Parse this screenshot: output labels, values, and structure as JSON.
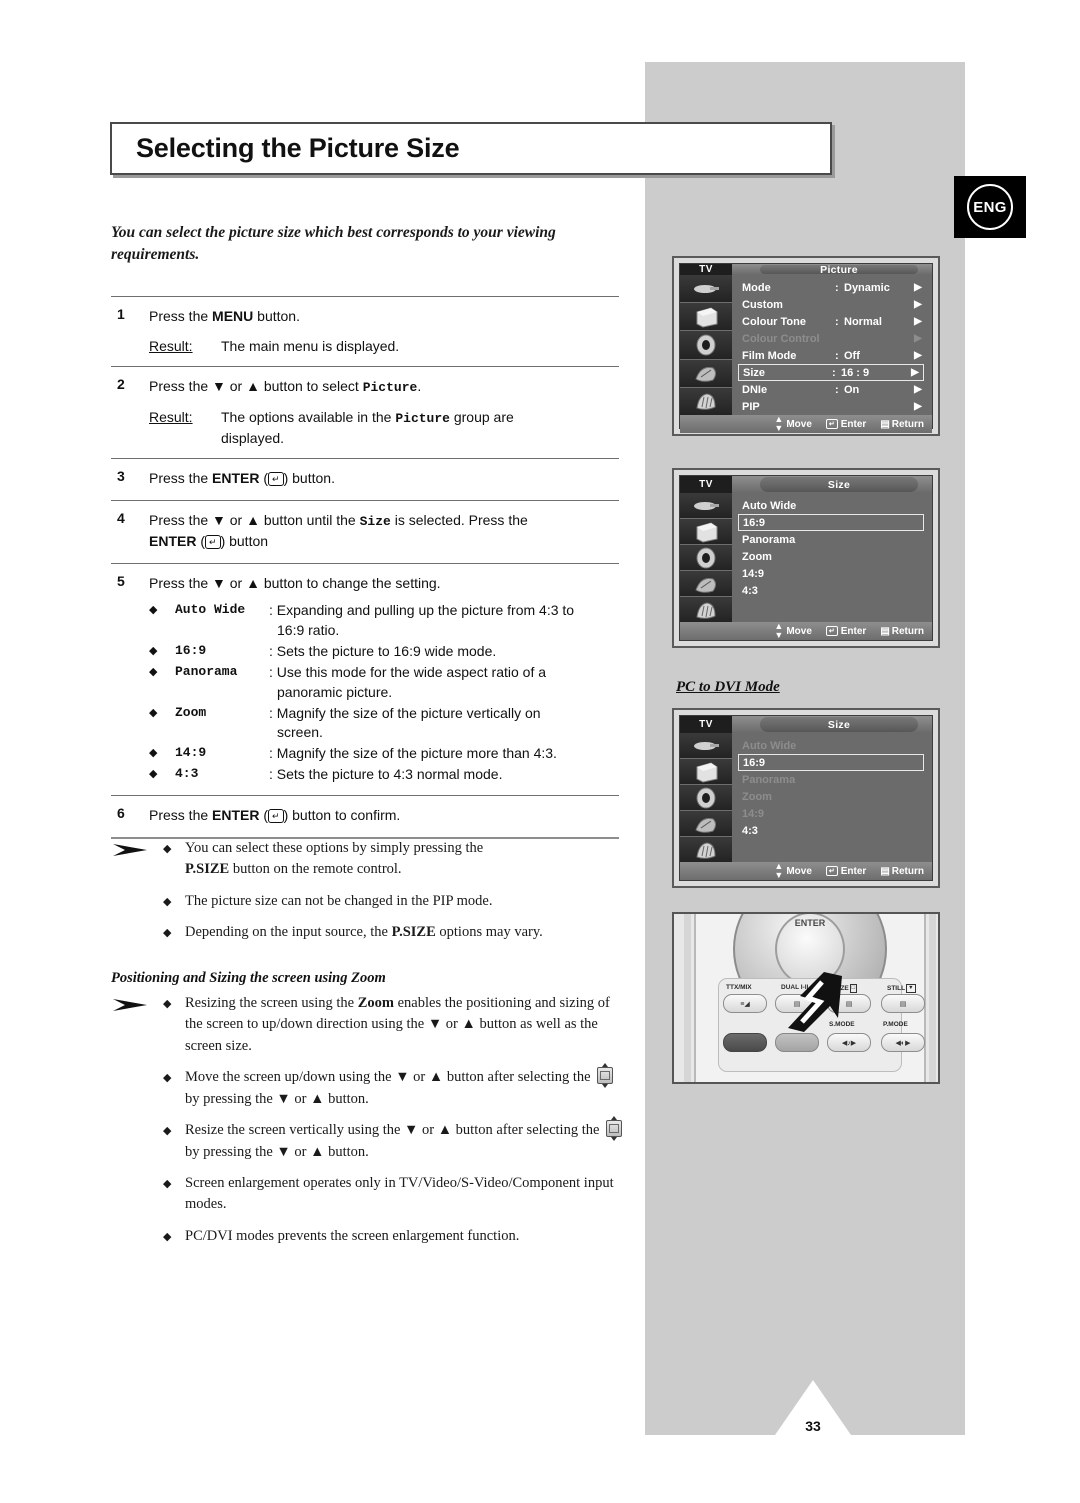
{
  "page": {
    "title": "Selecting the Picture Size",
    "language_badge": "ENG",
    "page_number": "33",
    "intro": "You can select the picture size which best corresponds to your viewing requirements."
  },
  "steps": [
    {
      "num": "1",
      "text_before": "Press the ",
      "bold": "MENU",
      "text_after": " button.",
      "result_label": "Result:",
      "result_text": "The main menu is displayed."
    },
    {
      "num": "2",
      "result_label": "Result:",
      "result_text": "The options available in the Picture group are displayed."
    },
    {
      "num": "3",
      "text": "Press the ENTER (   ) button."
    },
    {
      "num": "4",
      "text": "Press the ▼ or ▲ button until the Size is selected. Press the ENTER (   ) button"
    },
    {
      "num": "5",
      "text": "Press the ▼ or ▲ button to change the setting."
    },
    {
      "num": "6",
      "text": "Press the ENTER (   ) button to confirm."
    }
  ],
  "step2": {
    "lead": "Press the ▼ or ▲ button to select ",
    "mono": "Picture",
    "tail": ".",
    "result_label": "Result:",
    "result_a": "The options available in the ",
    "result_mono": "Picture",
    "result_b": " group are",
    "result_c": "displayed."
  },
  "step3": {
    "a": "Press the ",
    "bold": "ENTER",
    "b": " (",
    "c": ") button."
  },
  "step4": {
    "a": "Press the ▼ or ▲ button until the ",
    "mono": "Size",
    "b": " is selected. Press the",
    "bold": "ENTER",
    "c": " (",
    "d": ") button"
  },
  "step5": {
    "lead": "Press the ▼ or ▲ button to change the setting.",
    "options": [
      {
        "name": "Auto Wide",
        "desc_line1": ": Expanding and pulling up the picture from 4:3 to",
        "desc_line2": "16:9 ratio."
      },
      {
        "name": "16:9",
        "desc_line1": ": Sets the picture to 16:9 wide mode.",
        "desc_line2": ""
      },
      {
        "name": "Panorama",
        "desc_line1": ": Use this mode for the wide aspect ratio of a",
        "desc_line2": "panoramic picture."
      },
      {
        "name": "Zoom",
        "desc_line1": ": Magnify the size of the picture vertically on",
        "desc_line2": "screen."
      },
      {
        "name": "14:9",
        "desc_line1": ": Magnify the size of the picture more than 4:3.",
        "desc_line2": ""
      },
      {
        "name": "4:3",
        "desc_line1": ": Sets the picture to 4:3 normal mode.",
        "desc_line2": ""
      }
    ]
  },
  "step6": {
    "a": "Press the ",
    "bold": "ENTER",
    "b": " (",
    "c": ") button to confirm."
  },
  "notes_group1": [
    {
      "line1_a": "You can select these options by simply pressing the ",
      "bold": "P.SIZE",
      "line2_b": " button on the remote control."
    },
    {
      "plain": "The picture size can not be changed in the PIP mode."
    },
    {
      "line1_a": "Depending on the input source, the ",
      "bold": "P.SIZE",
      "line2_b": " options may vary."
    }
  ],
  "subheading": "Positioning and Sizing the screen using Zoom",
  "notes_group2": [
    {
      "a": "Resizing the screen using the ",
      "bold": "Zoom",
      "b": " enables the positioning and sizing of the screen to up/down direction using the ▼ or ▲ button as well as the screen size."
    },
    {
      "a": "Move the screen up/down using the ▼ or ▲ button after selecting the ",
      "b": " by pressing the ▼ or ▲ button."
    },
    {
      "a": "Resize the screen vertically using the ▼ or ▲ button after selecting the ",
      "b": " by pressing the ▼ or ▲ button."
    },
    {
      "plain": "Screen enlargement operates only in TV/Video/S-Video/Component input modes."
    },
    {
      "plain": "PC/DVI modes prevents the screen enlargement function."
    }
  ],
  "osd_picture": {
    "source_label": "TV",
    "title": "Picture",
    "rows": [
      {
        "label": "Mode",
        "colon": ":",
        "value": "Dynamic",
        "state": "normal",
        "arrow": "▶"
      },
      {
        "label": "Custom",
        "colon": "",
        "value": "",
        "state": "normal",
        "arrow": "▶"
      },
      {
        "label": "Colour Tone",
        "colon": ":",
        "value": "Normal",
        "state": "normal",
        "arrow": "▶"
      },
      {
        "label": "Colour Control",
        "colon": "",
        "value": "",
        "state": "disabled",
        "arrow": "▶"
      },
      {
        "label": "Film Mode",
        "colon": ":",
        "value": "Off",
        "state": "normal",
        "arrow": "▶"
      },
      {
        "label": "Size",
        "colon": ":",
        "value": "16 : 9",
        "state": "selected",
        "arrow": "▶"
      },
      {
        "label": "DNIe",
        "colon": ":",
        "value": "On",
        "state": "normal",
        "arrow": "▶"
      },
      {
        "label": "PIP",
        "colon": "",
        "value": "",
        "state": "normal",
        "arrow": "▶"
      }
    ],
    "footer": {
      "move": "Move",
      "enter": "Enter",
      "return": "Return"
    }
  },
  "osd_size": {
    "source_label": "TV",
    "title": "Size",
    "rows": [
      {
        "label": "Auto Wide",
        "state": "normal"
      },
      {
        "label": "16:9",
        "state": "selected"
      },
      {
        "label": "Panorama",
        "state": "normal"
      },
      {
        "label": "Zoom",
        "state": "normal"
      },
      {
        "label": "14:9",
        "state": "normal"
      },
      {
        "label": "4:3",
        "state": "normal"
      }
    ],
    "footer": {
      "move": "Move",
      "enter": "Enter",
      "return": "Return"
    }
  },
  "osd_size_pcdvi": {
    "heading": "PC to DVI Mode",
    "source_label": "TV",
    "title": "Size",
    "rows": [
      {
        "label": "Auto Wide",
        "state": "disabled"
      },
      {
        "label": "16:9",
        "state": "selected"
      },
      {
        "label": "Panorama",
        "state": "disabled"
      },
      {
        "label": "Zoom",
        "state": "disabled"
      },
      {
        "label": "14:9",
        "state": "disabled"
      },
      {
        "label": "4:3",
        "state": "normal"
      }
    ],
    "footer": {
      "move": "Move",
      "enter": "Enter",
      "return": "Return"
    }
  },
  "remote": {
    "center_label": "ENTER",
    "buttons_row1": [
      {
        "label": "TTX/MIX"
      },
      {
        "label": "DUAL I-II"
      },
      {
        "label": "P.SIZE"
      },
      {
        "label": "STILL"
      }
    ],
    "buttons_row2": [
      {
        "label": ""
      },
      {
        "label": ""
      },
      {
        "label": "S.MODE"
      },
      {
        "label": "P.MODE"
      }
    ]
  }
}
